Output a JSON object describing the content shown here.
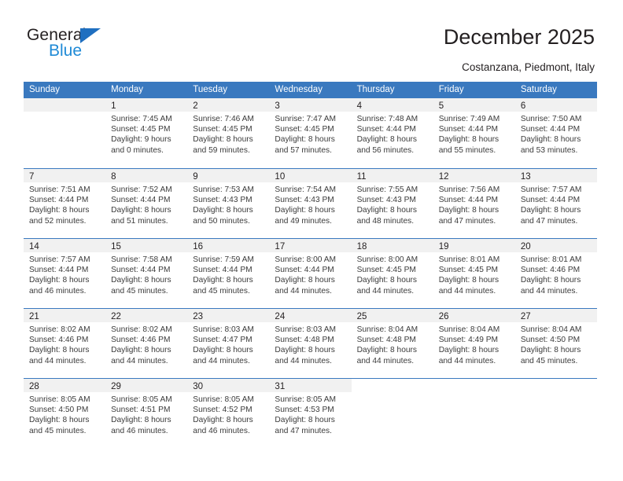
{
  "brand": {
    "name_top": "General",
    "name_bottom": "Blue",
    "accent_color": "#1f8ad6",
    "triangle_color": "#1f6fc0"
  },
  "header": {
    "title": "December 2025",
    "location": "Costanzana, Piedmont, Italy"
  },
  "calendar": {
    "header_bg": "#3a79bf",
    "daynum_band_bg": "#f1f1f1",
    "weekdays": [
      "Sunday",
      "Monday",
      "Tuesday",
      "Wednesday",
      "Thursday",
      "Friday",
      "Saturday"
    ],
    "weeks": [
      [
        {
          "day": "",
          "lines": []
        },
        {
          "day": "1",
          "lines": [
            "Sunrise: 7:45 AM",
            "Sunset: 4:45 PM",
            "Daylight: 9 hours",
            "and 0 minutes."
          ]
        },
        {
          "day": "2",
          "lines": [
            "Sunrise: 7:46 AM",
            "Sunset: 4:45 PM",
            "Daylight: 8 hours",
            "and 59 minutes."
          ]
        },
        {
          "day": "3",
          "lines": [
            "Sunrise: 7:47 AM",
            "Sunset: 4:45 PM",
            "Daylight: 8 hours",
            "and 57 minutes."
          ]
        },
        {
          "day": "4",
          "lines": [
            "Sunrise: 7:48 AM",
            "Sunset: 4:44 PM",
            "Daylight: 8 hours",
            "and 56 minutes."
          ]
        },
        {
          "day": "5",
          "lines": [
            "Sunrise: 7:49 AM",
            "Sunset: 4:44 PM",
            "Daylight: 8 hours",
            "and 55 minutes."
          ]
        },
        {
          "day": "6",
          "lines": [
            "Sunrise: 7:50 AM",
            "Sunset: 4:44 PM",
            "Daylight: 8 hours",
            "and 53 minutes."
          ]
        }
      ],
      [
        {
          "day": "7",
          "lines": [
            "Sunrise: 7:51 AM",
            "Sunset: 4:44 PM",
            "Daylight: 8 hours",
            "and 52 minutes."
          ]
        },
        {
          "day": "8",
          "lines": [
            "Sunrise: 7:52 AM",
            "Sunset: 4:44 PM",
            "Daylight: 8 hours",
            "and 51 minutes."
          ]
        },
        {
          "day": "9",
          "lines": [
            "Sunrise: 7:53 AM",
            "Sunset: 4:43 PM",
            "Daylight: 8 hours",
            "and 50 minutes."
          ]
        },
        {
          "day": "10",
          "lines": [
            "Sunrise: 7:54 AM",
            "Sunset: 4:43 PM",
            "Daylight: 8 hours",
            "and 49 minutes."
          ]
        },
        {
          "day": "11",
          "lines": [
            "Sunrise: 7:55 AM",
            "Sunset: 4:43 PM",
            "Daylight: 8 hours",
            "and 48 minutes."
          ]
        },
        {
          "day": "12",
          "lines": [
            "Sunrise: 7:56 AM",
            "Sunset: 4:44 PM",
            "Daylight: 8 hours",
            "and 47 minutes."
          ]
        },
        {
          "day": "13",
          "lines": [
            "Sunrise: 7:57 AM",
            "Sunset: 4:44 PM",
            "Daylight: 8 hours",
            "and 47 minutes."
          ]
        }
      ],
      [
        {
          "day": "14",
          "lines": [
            "Sunrise: 7:57 AM",
            "Sunset: 4:44 PM",
            "Daylight: 8 hours",
            "and 46 minutes."
          ]
        },
        {
          "day": "15",
          "lines": [
            "Sunrise: 7:58 AM",
            "Sunset: 4:44 PM",
            "Daylight: 8 hours",
            "and 45 minutes."
          ]
        },
        {
          "day": "16",
          "lines": [
            "Sunrise: 7:59 AM",
            "Sunset: 4:44 PM",
            "Daylight: 8 hours",
            "and 45 minutes."
          ]
        },
        {
          "day": "17",
          "lines": [
            "Sunrise: 8:00 AM",
            "Sunset: 4:44 PM",
            "Daylight: 8 hours",
            "and 44 minutes."
          ]
        },
        {
          "day": "18",
          "lines": [
            "Sunrise: 8:00 AM",
            "Sunset: 4:45 PM",
            "Daylight: 8 hours",
            "and 44 minutes."
          ]
        },
        {
          "day": "19",
          "lines": [
            "Sunrise: 8:01 AM",
            "Sunset: 4:45 PM",
            "Daylight: 8 hours",
            "and 44 minutes."
          ]
        },
        {
          "day": "20",
          "lines": [
            "Sunrise: 8:01 AM",
            "Sunset: 4:46 PM",
            "Daylight: 8 hours",
            "and 44 minutes."
          ]
        }
      ],
      [
        {
          "day": "21",
          "lines": [
            "Sunrise: 8:02 AM",
            "Sunset: 4:46 PM",
            "Daylight: 8 hours",
            "and 44 minutes."
          ]
        },
        {
          "day": "22",
          "lines": [
            "Sunrise: 8:02 AM",
            "Sunset: 4:46 PM",
            "Daylight: 8 hours",
            "and 44 minutes."
          ]
        },
        {
          "day": "23",
          "lines": [
            "Sunrise: 8:03 AM",
            "Sunset: 4:47 PM",
            "Daylight: 8 hours",
            "and 44 minutes."
          ]
        },
        {
          "day": "24",
          "lines": [
            "Sunrise: 8:03 AM",
            "Sunset: 4:48 PM",
            "Daylight: 8 hours",
            "and 44 minutes."
          ]
        },
        {
          "day": "25",
          "lines": [
            "Sunrise: 8:04 AM",
            "Sunset: 4:48 PM",
            "Daylight: 8 hours",
            "and 44 minutes."
          ]
        },
        {
          "day": "26",
          "lines": [
            "Sunrise: 8:04 AM",
            "Sunset: 4:49 PM",
            "Daylight: 8 hours",
            "and 44 minutes."
          ]
        },
        {
          "day": "27",
          "lines": [
            "Sunrise: 8:04 AM",
            "Sunset: 4:50 PM",
            "Daylight: 8 hours",
            "and 45 minutes."
          ]
        }
      ],
      [
        {
          "day": "28",
          "lines": [
            "Sunrise: 8:05 AM",
            "Sunset: 4:50 PM",
            "Daylight: 8 hours",
            "and 45 minutes."
          ]
        },
        {
          "day": "29",
          "lines": [
            "Sunrise: 8:05 AM",
            "Sunset: 4:51 PM",
            "Daylight: 8 hours",
            "and 46 minutes."
          ]
        },
        {
          "day": "30",
          "lines": [
            "Sunrise: 8:05 AM",
            "Sunset: 4:52 PM",
            "Daylight: 8 hours",
            "and 46 minutes."
          ]
        },
        {
          "day": "31",
          "lines": [
            "Sunrise: 8:05 AM",
            "Sunset: 4:53 PM",
            "Daylight: 8 hours",
            "and 47 minutes."
          ]
        },
        {
          "day": "",
          "lines": []
        },
        {
          "day": "",
          "lines": []
        },
        {
          "day": "",
          "lines": []
        }
      ]
    ]
  }
}
